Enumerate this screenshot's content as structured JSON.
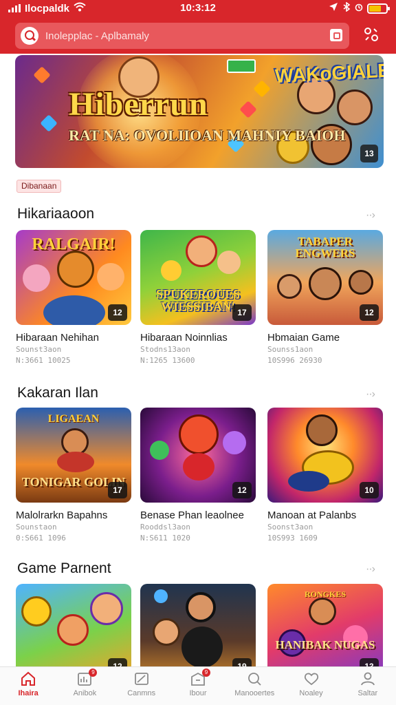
{
  "status_bar": {
    "carrier": "Ilocpaldk",
    "time": "10:3:12",
    "battery_level": 0.7
  },
  "header": {
    "search_placeholder": "Inolepplac - Aplbamaly"
  },
  "banner": {
    "title": "Hiberrun",
    "subtitle": "RAT NA: OVOLIIOAN MAHNIY BAIOH",
    "logo_text": "WAKoGIALEN!",
    "badge": "13"
  },
  "tag_label": "Dibanaan",
  "sections": [
    {
      "title": "Hikariaaoon",
      "games": [
        {
          "name": "Hibaraan Nehihan",
          "meta1": "Sounst3aon",
          "meta2": "N:3661 10025",
          "count": "12",
          "art": "RALGAIR!"
        },
        {
          "name": "Hibaraan Noinnlias",
          "meta1": "Stodns13aon",
          "meta2": "N:1265 13600",
          "count": "17",
          "art": "SPUKEROUES WIESSIBAN!"
        },
        {
          "name": "Hbmaian Game",
          "meta1": "Sounss1aon",
          "meta2": "10S996 26930",
          "count": "12",
          "art": "TABAPER ENGWERS"
        }
      ]
    },
    {
      "title": "Kakaran Ilan",
      "games": [
        {
          "name": "Malolrarkn Bapahns",
          "meta1": "Sounstaon",
          "meta2": "0:S661 1096",
          "count": "17",
          "art": "TONIGAR GOLIN"
        },
        {
          "name": "Benase Phan leaolnee",
          "meta1": "Rooddsl3aon",
          "meta2": "N:S611 1020",
          "count": "12",
          "art": ""
        },
        {
          "name": "Manoan at Palanbs",
          "meta1": "Soonst3aon",
          "meta2": "10S993 1609",
          "count": "10",
          "art": ""
        }
      ]
    },
    {
      "title": "Game Parnent",
      "games": [
        {
          "name": "",
          "meta1": "",
          "meta2": "",
          "count": "12",
          "art": ""
        },
        {
          "name": "",
          "meta1": "",
          "meta2": "",
          "count": "19",
          "art": ""
        },
        {
          "name": "",
          "meta1": "",
          "meta2": "",
          "count": "13",
          "art": "HANIBAK NUGAS"
        }
      ]
    }
  ],
  "bottom_nav": [
    {
      "label": "Ihaira",
      "icon": "home-icon",
      "badge": ""
    },
    {
      "label": "Anibok",
      "icon": "chart-icon",
      "badge": "9"
    },
    {
      "label": "Canmns",
      "icon": "image-icon",
      "badge": ""
    },
    {
      "label": "Ibour",
      "icon": "inbox-icon",
      "badge": "9"
    },
    {
      "label": "Manooertes",
      "icon": "search-icon",
      "badge": ""
    },
    {
      "label": "Noaley",
      "icon": "heart-icon",
      "badge": ""
    },
    {
      "label": "Saltar",
      "icon": "profile-icon",
      "badge": ""
    }
  ],
  "colors": {
    "brand_red": "#d8262b",
    "text": "#1a1a1a",
    "muted": "#9a9a9a"
  }
}
